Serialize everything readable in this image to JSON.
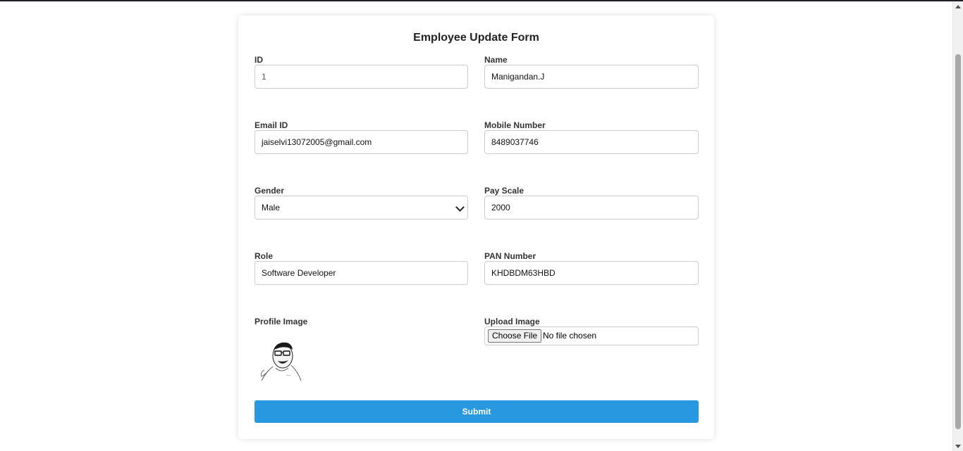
{
  "form": {
    "title": "Employee Update Form",
    "fields": {
      "id": {
        "label": "ID",
        "value": "1"
      },
      "name": {
        "label": "Name",
        "value": "Manigandan.J"
      },
      "email": {
        "label": "Email ID",
        "value": "jaiselvi13072005@gmail.com"
      },
      "mobile": {
        "label": "Mobile Number",
        "value": "8489037746"
      },
      "gender": {
        "label": "Gender",
        "value": "Male"
      },
      "pay_scale": {
        "label": "Pay Scale",
        "value": "2000"
      },
      "role": {
        "label": "Role",
        "value": "Software Developer"
      },
      "pan": {
        "label": "PAN Number",
        "value": "KHDBDM63HBD"
      },
      "profile_image": {
        "label": "Profile Image"
      },
      "upload_image": {
        "label": "Upload Image",
        "button_label": "Choose File",
        "status": "No file chosen"
      }
    },
    "submit_label": "Submit"
  },
  "colors": {
    "accent": "#2898e0",
    "border": "#cccccc"
  }
}
